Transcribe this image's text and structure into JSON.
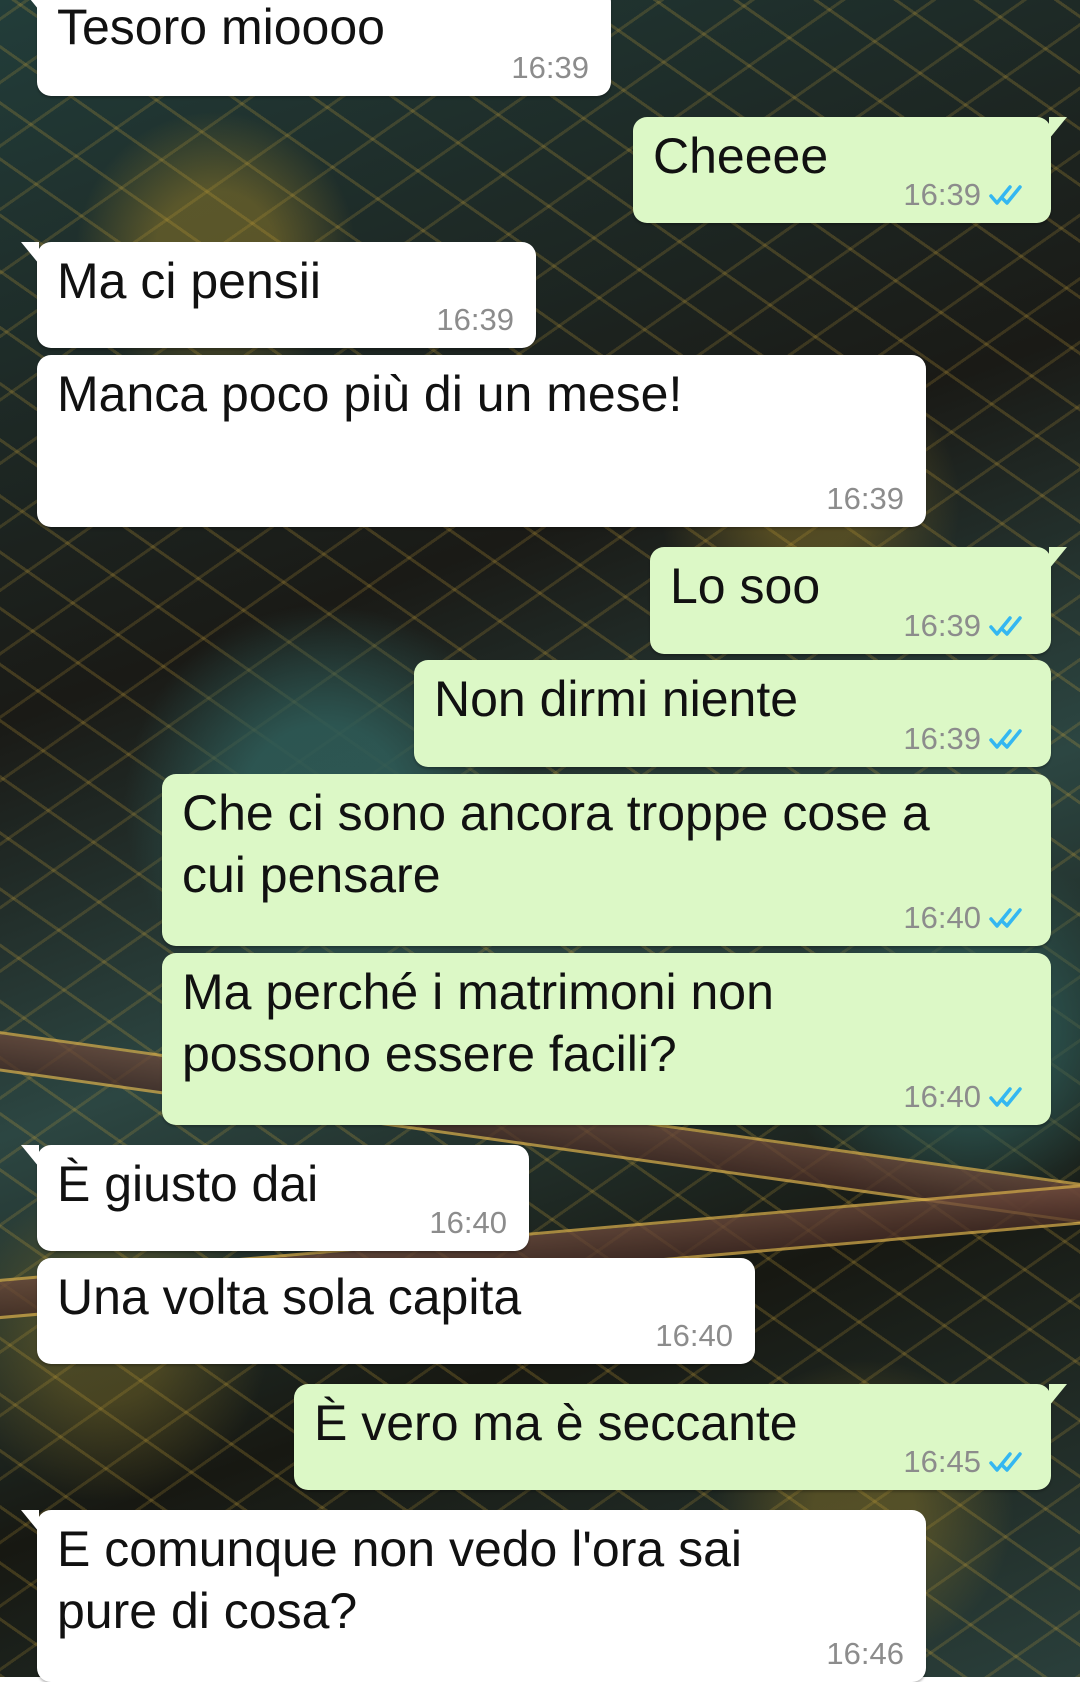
{
  "colors": {
    "incoming_bubble": "#ffffff",
    "outgoing_bubble": "#dcf8c6",
    "timestamp": "#8c8c8c",
    "read_check": "#34b7f1"
  },
  "messages": [
    {
      "direction": "in",
      "lines": [
        "Tesoro mioooo"
      ],
      "time": "16:39"
    },
    {
      "direction": "out",
      "lines": [
        "Cheeee"
      ],
      "time": "16:39",
      "status": "read",
      "status_icon": "double-check-icon"
    },
    {
      "direction": "in",
      "lines": [
        "Ma ci pensii"
      ],
      "time": "16:39"
    },
    {
      "direction": "in",
      "lines": [
        "Manca poco più di un mese!"
      ],
      "time": "16:39"
    },
    {
      "direction": "out",
      "lines": [
        "Lo soo"
      ],
      "time": "16:39",
      "status": "read",
      "status_icon": "double-check-icon"
    },
    {
      "direction": "out",
      "lines": [
        "Non dirmi niente"
      ],
      "time": "16:39",
      "status": "read",
      "status_icon": "double-check-icon"
    },
    {
      "direction": "out",
      "lines": [
        "Che ci sono ancora troppe cose a",
        "cui pensare"
      ],
      "time": "16:40",
      "status": "read",
      "status_icon": "double-check-icon"
    },
    {
      "direction": "out",
      "lines": [
        "Ma perché i matrimoni non",
        "possono essere facili?"
      ],
      "time": "16:40",
      "status": "read",
      "status_icon": "double-check-icon"
    },
    {
      "direction": "in",
      "lines": [
        "È giusto dai"
      ],
      "time": "16:40"
    },
    {
      "direction": "in",
      "lines": [
        "Una volta sola capita"
      ],
      "time": "16:40"
    },
    {
      "direction": "out",
      "lines": [
        "È vero ma è seccante"
      ],
      "time": "16:45",
      "status": "read",
      "status_icon": "double-check-icon"
    },
    {
      "direction": "in",
      "lines": [
        "E comunque non vedo l'ora sai",
        "pure di cosa?"
      ],
      "time": "16:46"
    }
  ]
}
